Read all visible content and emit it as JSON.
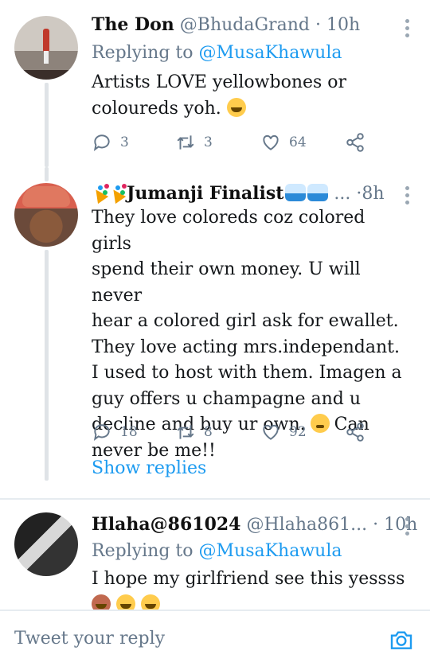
{
  "tweets": [
    {
      "name": "The Don",
      "handle": "@BhudaGrand",
      "time": "10h",
      "replying_label": "Replying to",
      "replying_to": "@MusaKhawula",
      "text": "Artists LOVE yellowbones or coloureds yoh.",
      "replies": "3",
      "retweets": "3",
      "likes": "64"
    },
    {
      "name": "Jumanji Finalist",
      "handle": "...",
      "time": "8h",
      "text_lines": [
        "They love coloreds coz colored girls",
        "spend their own money. U will never",
        "hear a colored girl ask for ewallet.",
        "They love acting mrs.independant.",
        "I used to host with them. Imagen a",
        "guy offers u champagne and u",
        "decline and buy ur own.",
        "Can",
        "never be me!!"
      ],
      "replies": "18",
      "retweets": "8",
      "likes": "92",
      "show_replies": "Show replies"
    },
    {
      "name": "Hlaha@861024",
      "handle": "@Hlaha861...",
      "time": "10h",
      "replying_label": "Replying to",
      "replying_to": "@MusaKhawula",
      "text": "I hope my girlfriend see this yessss"
    }
  ],
  "composer": {
    "placeholder": "Tweet your reply"
  },
  "icons": [
    "reply-icon",
    "retweet-icon",
    "like-icon",
    "share-icon",
    "more-icon",
    "camera-icon"
  ],
  "colors": {
    "accent": "#1d9bf0",
    "muted": "#65778a",
    "thread_line": "#dfe3e7"
  }
}
